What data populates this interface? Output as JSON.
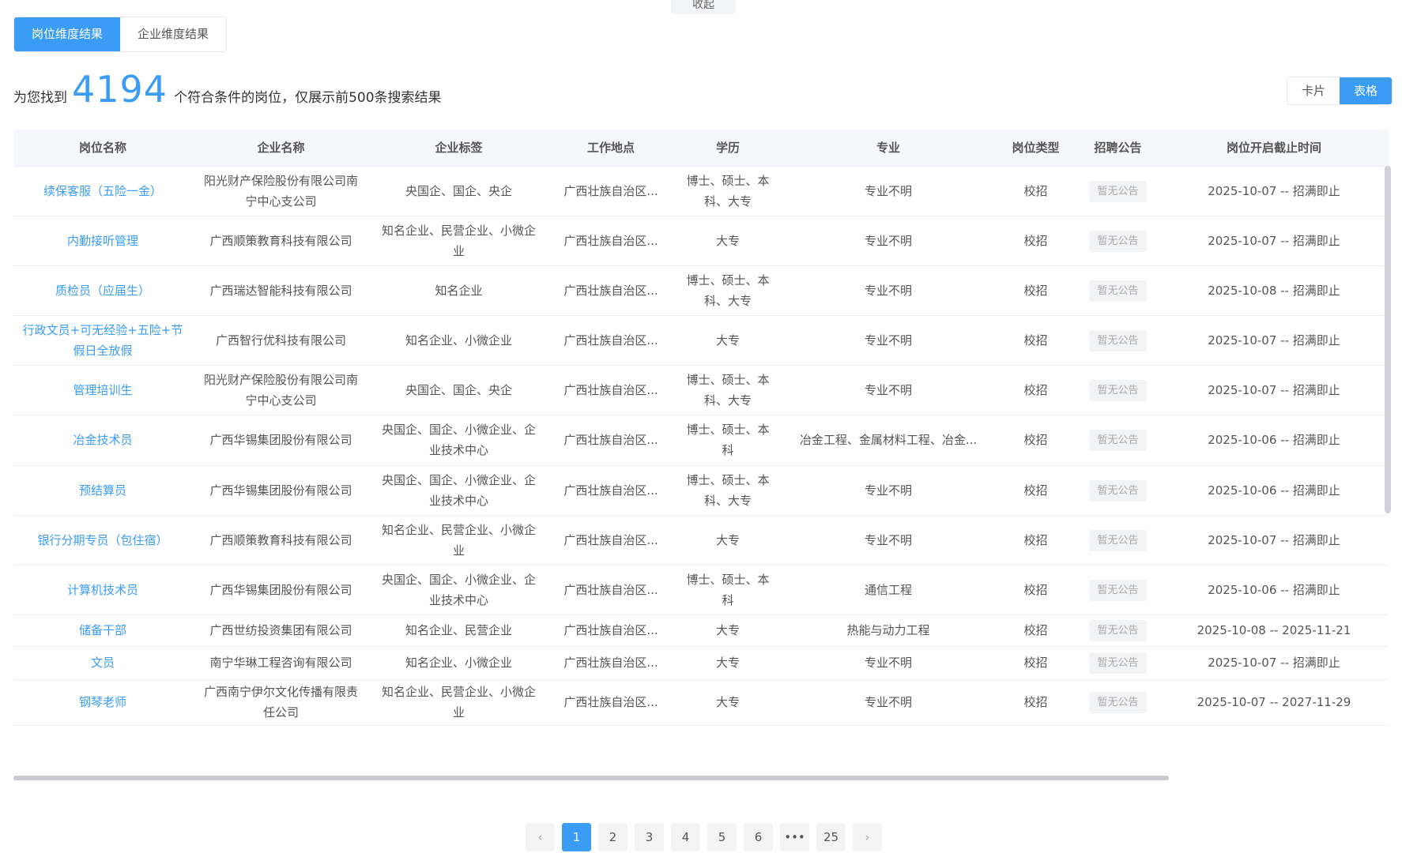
{
  "collapse_label": "收起",
  "tabs": [
    {
      "label": "岗位维度结果",
      "active": true
    },
    {
      "label": "企业维度结果",
      "active": false
    }
  ],
  "summary": {
    "prefix": "为您找到",
    "count": "4194",
    "suffix": "个符合条件的岗位，仅展示前500条搜索结果"
  },
  "view_toggle": {
    "card": "卡片",
    "table": "表格"
  },
  "table": {
    "headers": [
      "岗位名称",
      "企业名称",
      "企业标签",
      "工作地点",
      "学历",
      "专业",
      "岗位类型",
      "招聘公告",
      "岗位开启截止时间"
    ],
    "rows": [
      {
        "job": "续保客服（五险一金）",
        "company": "阳光财产保险股份有限公司南宁中心支公司",
        "tags": "央国企、国企、央企",
        "location": "广西壮族自治区...",
        "education": "博士、硕士、本科、大专",
        "major": "专业不明",
        "type": "校招",
        "notice": "暂无公告",
        "period": "2025-10-07 -- 招满即止"
      },
      {
        "job": "内勤接听管理",
        "company": "广西顺策教育科技有限公司",
        "tags": "知名企业、民营企业、小微企业",
        "location": "广西壮族自治区...",
        "education": "大专",
        "major": "专业不明",
        "type": "校招",
        "notice": "暂无公告",
        "period": "2025-10-07 -- 招满即止"
      },
      {
        "job": "质检员（应届生）",
        "company": "广西瑞达智能科技有限公司",
        "tags": "知名企业",
        "location": "广西壮族自治区...",
        "education": "博士、硕士、本科、大专",
        "major": "专业不明",
        "type": "校招",
        "notice": "暂无公告",
        "period": "2025-10-08 -- 招满即止"
      },
      {
        "job": "行政文员+可无经验+五险+节假日全放假",
        "company": "广西智行优科技有限公司",
        "tags": "知名企业、小微企业",
        "location": "广西壮族自治区...",
        "education": "大专",
        "major": "专业不明",
        "type": "校招",
        "notice": "暂无公告",
        "period": "2025-10-07 -- 招满即止"
      },
      {
        "job": "管理培训生",
        "company": "阳光财产保险股份有限公司南宁中心支公司",
        "tags": "央国企、国企、央企",
        "location": "广西壮族自治区...",
        "education": "博士、硕士、本科、大专",
        "major": "专业不明",
        "type": "校招",
        "notice": "暂无公告",
        "period": "2025-10-07 -- 招满即止"
      },
      {
        "job": "冶金技术员",
        "company": "广西华锡集团股份有限公司",
        "tags": "央国企、国企、小微企业、企业技术中心",
        "location": "广西壮族自治区...",
        "education": "博士、硕士、本科",
        "major": "冶金工程、金属材料工程、冶金...",
        "type": "校招",
        "notice": "暂无公告",
        "period": "2025-10-06 -- 招满即止"
      },
      {
        "job": "预结算员",
        "company": "广西华锡集团股份有限公司",
        "tags": "央国企、国企、小微企业、企业技术中心",
        "location": "广西壮族自治区...",
        "education": "博士、硕士、本科、大专",
        "major": "专业不明",
        "type": "校招",
        "notice": "暂无公告",
        "period": "2025-10-06 -- 招满即止"
      },
      {
        "job": "银行分期专员（包住宿）",
        "company": "广西顺策教育科技有限公司",
        "tags": "知名企业、民营企业、小微企业",
        "location": "广西壮族自治区...",
        "education": "大专",
        "major": "专业不明",
        "type": "校招",
        "notice": "暂无公告",
        "period": "2025-10-07 -- 招满即止"
      },
      {
        "job": "计算机技术员",
        "company": "广西华锡集团股份有限公司",
        "tags": "央国企、国企、小微企业、企业技术中心",
        "location": "广西壮族自治区...",
        "education": "博士、硕士、本科",
        "major": "通信工程",
        "type": "校招",
        "notice": "暂无公告",
        "period": "2025-10-06 -- 招满即止"
      },
      {
        "job": "储备干部",
        "company": "广西世纺投资集团有限公司",
        "tags": "知名企业、民营企业",
        "location": "广西壮族自治区...",
        "education": "大专",
        "major": "热能与动力工程",
        "type": "校招",
        "notice": "暂无公告",
        "period": "2025-10-08 -- 2025-11-21"
      },
      {
        "job": "文员",
        "company": "南宁华琳工程咨询有限公司",
        "tags": "知名企业、小微企业",
        "location": "广西壮族自治区...",
        "education": "大专",
        "major": "专业不明",
        "type": "校招",
        "notice": "暂无公告",
        "period": "2025-10-07 -- 招满即止"
      },
      {
        "job": "钢琴老师",
        "company": "广西南宁伊尔文化传播有限责任公司",
        "tags": "知名企业、民营企业、小微企业",
        "location": "广西壮族自治区...",
        "education": "大专",
        "major": "专业不明",
        "type": "校招",
        "notice": "暂无公告",
        "period": "2025-10-07 -- 2027-11-29"
      }
    ]
  },
  "pagination": {
    "prev_icon": "chevron-left-icon",
    "next_icon": "chevron-right-icon",
    "pages": [
      "1",
      "2",
      "3",
      "4",
      "5",
      "6",
      "•••",
      "25"
    ],
    "current": "1"
  },
  "colors": {
    "accent": "#3a9cf5"
  }
}
